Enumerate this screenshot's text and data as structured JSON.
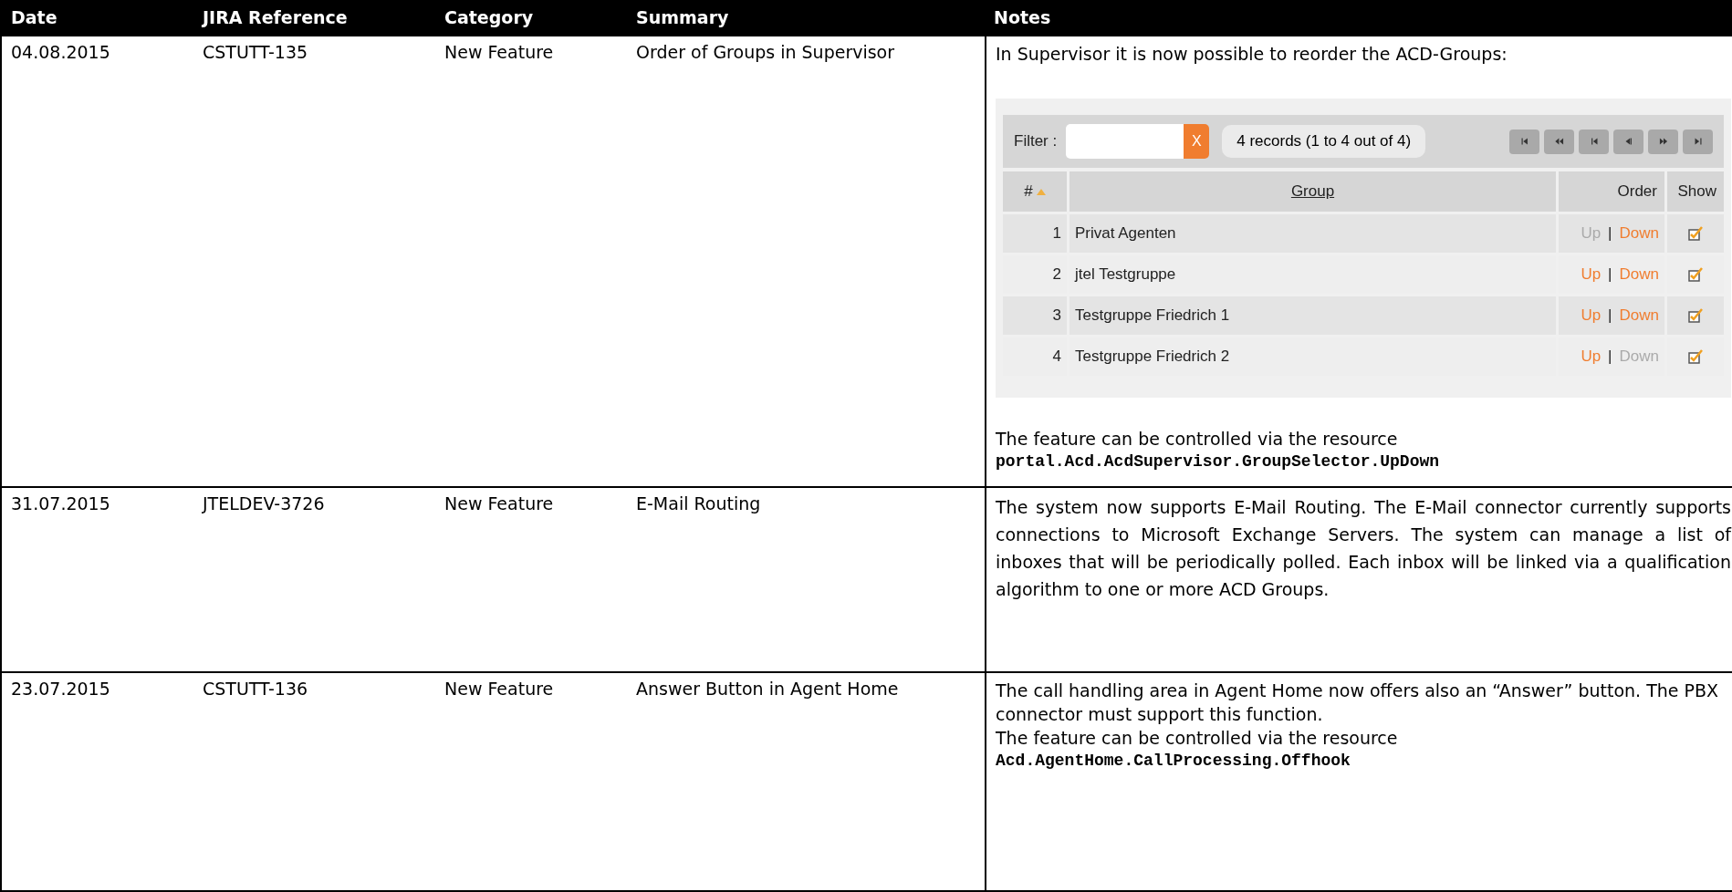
{
  "table": {
    "columns": [
      "Date",
      "JIRA Reference",
      "Category",
      "Summary",
      "Notes"
    ],
    "rows": [
      {
        "date": "04.08.2015",
        "reference": "CSTUTT-135",
        "category": "New Feature",
        "summary": "Order of Groups in Supervisor",
        "notes": [
          {
            "kind": "text",
            "text": "In Supervisor it is now possible to reorder the ACD-Groups:"
          },
          {
            "kind": "screenshot",
            "filter_label": "Filter :",
            "clear_button": "X",
            "records": "4 records (1 to 4 out of 4)",
            "columns": [
              "#",
              "Group",
              "Order",
              "Show"
            ],
            "groups": [
              {
                "number": "1",
                "name": "Privat Agenten",
                "up": "Up",
                "up_enabled": false,
                "separator": "|",
                "down": "Down",
                "down_enabled": true,
                "show": true
              },
              {
                "number": "2",
                "name": "jtel Testgruppe",
                "up": "Up",
                "up_enabled": true,
                "separator": "|",
                "down": "Down",
                "down_enabled": true,
                "show": true
              },
              {
                "number": "3",
                "name": "Testgruppe Friedrich 1",
                "up": "Up",
                "up_enabled": true,
                "separator": "|",
                "down": "Down",
                "down_enabled": true,
                "show": true
              },
              {
                "number": "4",
                "name": "Testgruppe Friedrich 2",
                "up": "Up",
                "up_enabled": true,
                "separator": "|",
                "down": "Down",
                "down_enabled": false,
                "show": true
              }
            ]
          },
          {
            "kind": "text",
            "text": "The feature can be controlled via the resource"
          },
          {
            "kind": "code",
            "text": "portal.Acd.AcdSupervisor.GroupSelector.UpDown"
          }
        ]
      },
      {
        "date": "31.07.2015",
        "reference": "JTELDEV-3726",
        "category": "New Feature",
        "summary": "E-Mail Routing",
        "notes": [
          {
            "kind": "paragraph",
            "text": "The system now supports E-Mail Routing. The E-Mail connector currently supports connections to Microsoft Exchange Servers. The system can manage a list of inboxes that will be periodically polled. Each inbox will be linked via a qualification algorithm to one or more ACD Groups."
          }
        ]
      },
      {
        "date": "23.07.2015",
        "reference": "CSTUTT-136",
        "category": "New Feature",
        "summary": "Answer Button in Agent Home",
        "notes": [
          {
            "kind": "text",
            "text": "The call handling area in Agent Home now offers also an “Answer” button. The PBX connector must support this function."
          },
          {
            "kind": "text",
            "text": "The feature can be controlled via the resource"
          },
          {
            "kind": "code",
            "text": "Acd.AgentHome.CallProcessing.Offhook"
          }
        ]
      }
    ]
  }
}
